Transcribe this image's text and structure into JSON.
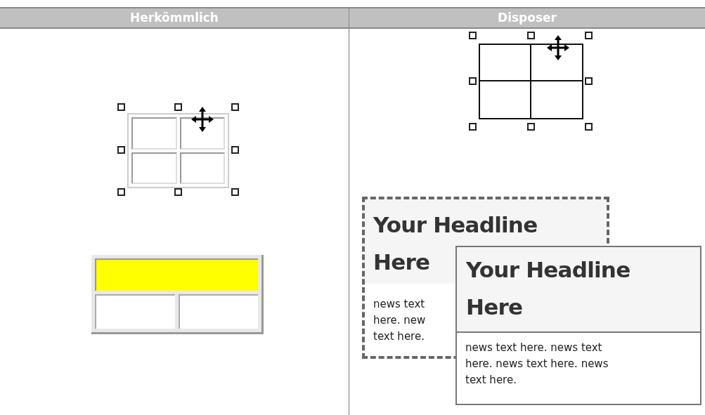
{
  "table": {
    "columns": [
      {
        "header": "Herkömmlich"
      },
      {
        "header": "Disposer"
      }
    ]
  },
  "disposer": {
    "back_card": {
      "headline_lines": [
        "Your Headline",
        "Here"
      ],
      "body_lines": [
        "news text",
        "here. new",
        "text here."
      ]
    },
    "front_card": {
      "headline_lines": [
        "Your Headline",
        "Here"
      ],
      "body": "news text here. news text here. news text here. news text here."
    }
  }
}
